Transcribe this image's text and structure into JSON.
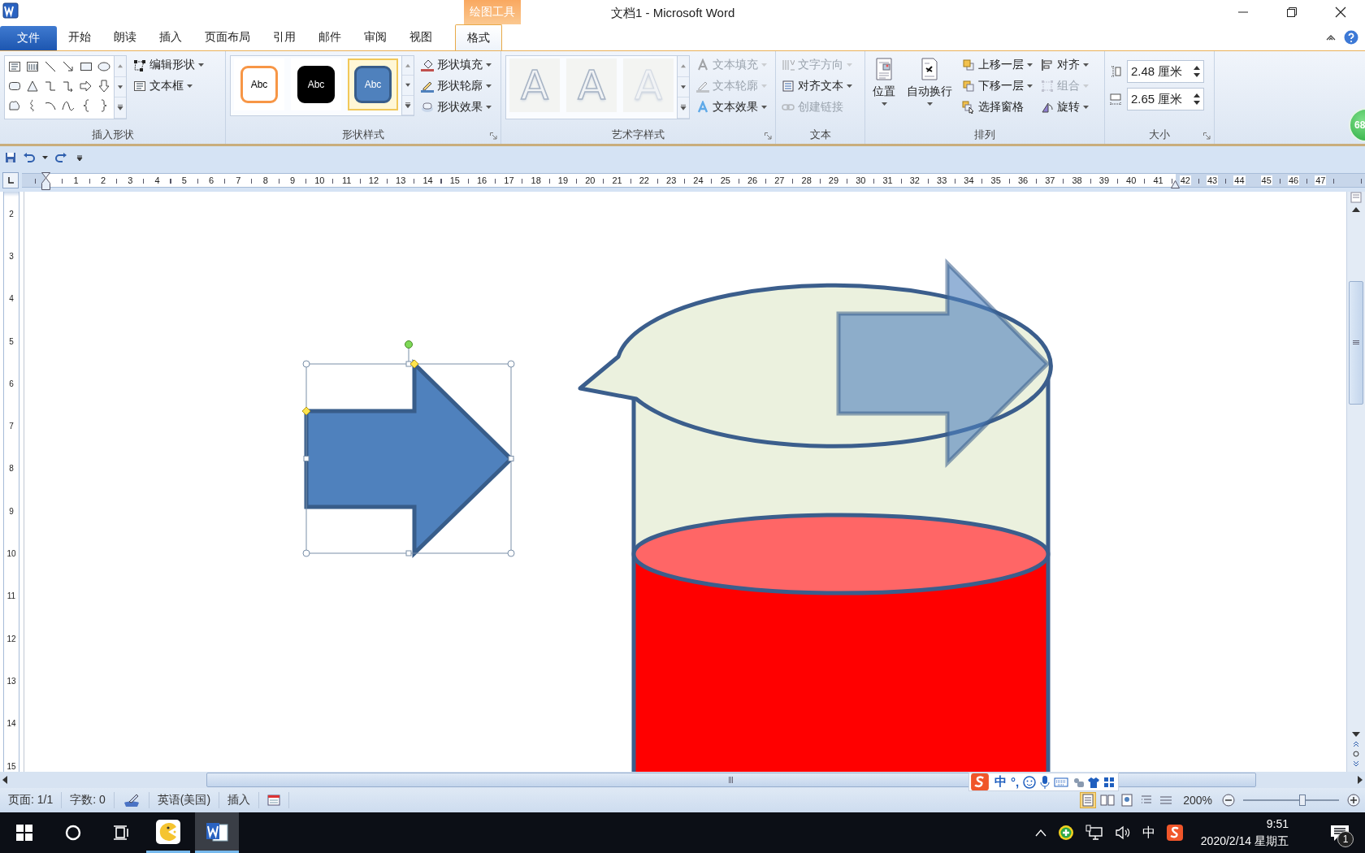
{
  "window": {
    "title": "文档1 - Microsoft Word",
    "contextual_tab": "绘图工具"
  },
  "tabs": [
    {
      "label": "文件",
      "kind": "file",
      "selected": false
    },
    {
      "label": "开始",
      "kind": "tab",
      "selected": false
    },
    {
      "label": "朗读",
      "kind": "tab",
      "selected": false
    },
    {
      "label": "插入",
      "kind": "tab",
      "selected": false
    },
    {
      "label": "页面布局",
      "kind": "tab",
      "selected": false
    },
    {
      "label": "引用",
      "kind": "tab",
      "selected": false
    },
    {
      "label": "邮件",
      "kind": "tab",
      "selected": false
    },
    {
      "label": "审阅",
      "kind": "tab",
      "selected": false
    },
    {
      "label": "视图",
      "kind": "tab",
      "selected": false
    },
    {
      "label": "格式",
      "kind": "contextual",
      "selected": true
    }
  ],
  "ribbon": {
    "groups": [
      {
        "kind": "shapes",
        "title": "插入形状",
        "launcher": false,
        "commands": [
          {
            "label": "编辑形状",
            "dropdown": true,
            "disabled": false
          },
          {
            "label": "文本框",
            "dropdown": true,
            "disabled": false
          }
        ]
      },
      {
        "kind": "styles",
        "title": "形状样式",
        "launcher": true,
        "styles": [
          {
            "label": "Abc",
            "kind": "outline",
            "color": "#f79646",
            "selected": false
          },
          {
            "label": "Abc",
            "kind": "fill",
            "color": "#000000",
            "selected": false
          },
          {
            "label": "Abc",
            "kind": "fill",
            "color": "#4f81bd",
            "selected": true
          }
        ],
        "commands": [
          {
            "label": "形状填充",
            "dropdown": true,
            "disabled": false
          },
          {
            "label": "形状轮廓",
            "dropdown": true,
            "disabled": false
          },
          {
            "label": "形状效果",
            "dropdown": true,
            "disabled": false
          }
        ]
      },
      {
        "kind": "wordart",
        "title": "艺术字样式",
        "launcher": true,
        "styles": [
          {
            "label": "A",
            "disabled": true
          },
          {
            "label": "A",
            "disabled": true
          },
          {
            "label": "A",
            "disabled": true
          }
        ],
        "commands": [
          {
            "label": "文本填充",
            "dropdown": true,
            "disabled": true
          },
          {
            "label": "文本轮廓",
            "dropdown": true,
            "disabled": true
          },
          {
            "label": "文本效果",
            "dropdown": true,
            "disabled": false
          }
        ]
      },
      {
        "kind": "text",
        "title": "文本",
        "launcher": false,
        "commands": [
          {
            "label": "文字方向",
            "dropdown": true,
            "disabled": true
          },
          {
            "label": "对齐文本",
            "dropdown": true,
            "disabled": false
          },
          {
            "label": "创建链接",
            "dropdown": false,
            "disabled": true
          }
        ]
      },
      {
        "kind": "arrange",
        "title": "排列",
        "launcher": false,
        "large": [
          {
            "label": "位置",
            "dropdown": true,
            "disabled": false
          },
          {
            "label": "自动换行",
            "dropdown": true,
            "disabled": false
          }
        ],
        "commands": [
          {
            "label": "上移一层",
            "dropdown": true,
            "disabled": false
          },
          {
            "label": "下移一层",
            "dropdown": true,
            "disabled": false
          },
          {
            "label": "选择窗格",
            "dropdown": false,
            "disabled": false
          },
          {
            "label": "对齐",
            "dropdown": true,
            "disabled": false
          },
          {
            "label": "组合",
            "dropdown": true,
            "disabled": true
          },
          {
            "label": "旋转",
            "dropdown": true,
            "disabled": false
          }
        ]
      },
      {
        "kind": "size",
        "title": "大小",
        "launcher": true,
        "fields": [
          {
            "value": "2.48 厘米"
          },
          {
            "value": "2.65 厘米"
          }
        ]
      }
    ]
  },
  "floating_badge": {
    "text": "68"
  },
  "ruler": {
    "horizontal": [
      "1",
      "2",
      "3",
      "4",
      "5",
      "6",
      "7",
      "8",
      "9",
      "10",
      "11",
      "12",
      "13",
      "14",
      "15",
      "16",
      "17",
      "18",
      "19",
      "20",
      "21",
      "22",
      "23",
      "24",
      "25",
      "26",
      "27",
      "28",
      "29",
      "30",
      "31",
      "32",
      "33",
      "34",
      "35",
      "36",
      "37",
      "38",
      "39",
      "40",
      "41",
      "42",
      "43",
      "44",
      "45",
      "46",
      "47"
    ],
    "vertical": [
      "2",
      "3",
      "4",
      "5",
      "6",
      "7",
      "8",
      "9",
      "10",
      "11",
      "12",
      "13",
      "14",
      "15"
    ]
  },
  "document": {
    "shapes": [
      {
        "kind": "cylinder"
      },
      {
        "kind": "callout"
      },
      {
        "kind": "block_arrow",
        "selected": false,
        "transparent": true
      },
      {
        "kind": "block_arrow",
        "selected": true,
        "transparent": false
      }
    ]
  },
  "status_bar": {
    "page": "页面: 1/1",
    "words": "字数: 0",
    "language": "英语(美国)",
    "mode": "插入",
    "views": [
      {
        "selected": true
      },
      {
        "selected": false
      },
      {
        "selected": false
      },
      {
        "selected": false
      },
      {
        "selected": false
      }
    ],
    "zoom": {
      "label": "200%",
      "level": 0.62
    }
  },
  "ime_toolbar": {
    "mode": "中",
    "punctuation": "°,"
  },
  "taskbar": {
    "apps": [
      {
        "kind": "game",
        "selected": false
      },
      {
        "kind": "word",
        "selected": true
      }
    ],
    "tray": {
      "ime": "中",
      "time": "9:51",
      "date": "2020/2/14 星期五",
      "notifications": "1"
    }
  }
}
